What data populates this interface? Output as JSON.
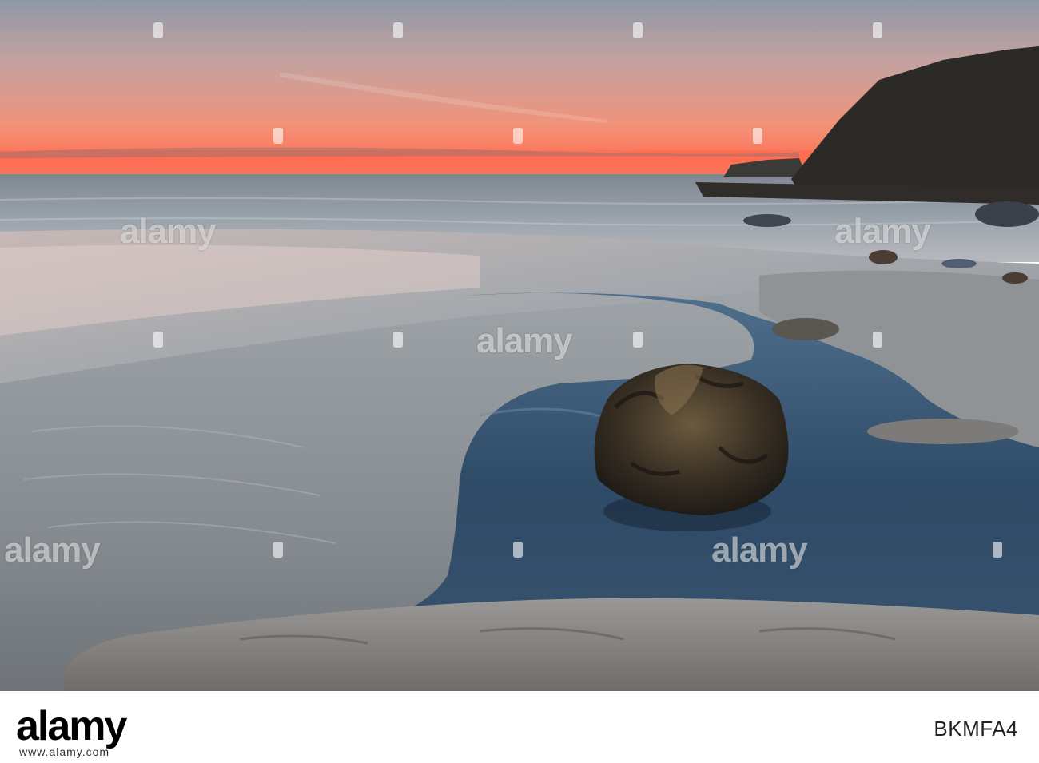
{
  "photo": {
    "description_colors": {
      "sky_top": "#9aa3b0",
      "sky_glow": "#f08a6e",
      "horizon": "#ff6f55",
      "sea": "#8c96a0",
      "sand": "#8a8f95",
      "pool": "#2e4a66",
      "cliff": "#2b2a26",
      "rock": "#3b3326"
    },
    "icons": [
      "seaweed-rock",
      "cliff",
      "tide-pool"
    ]
  },
  "watermarks": {
    "text": "alamy"
  },
  "footer": {
    "logo_text": "alamy",
    "image_id": "BKMFA4",
    "domain": "www.alamy.com"
  }
}
